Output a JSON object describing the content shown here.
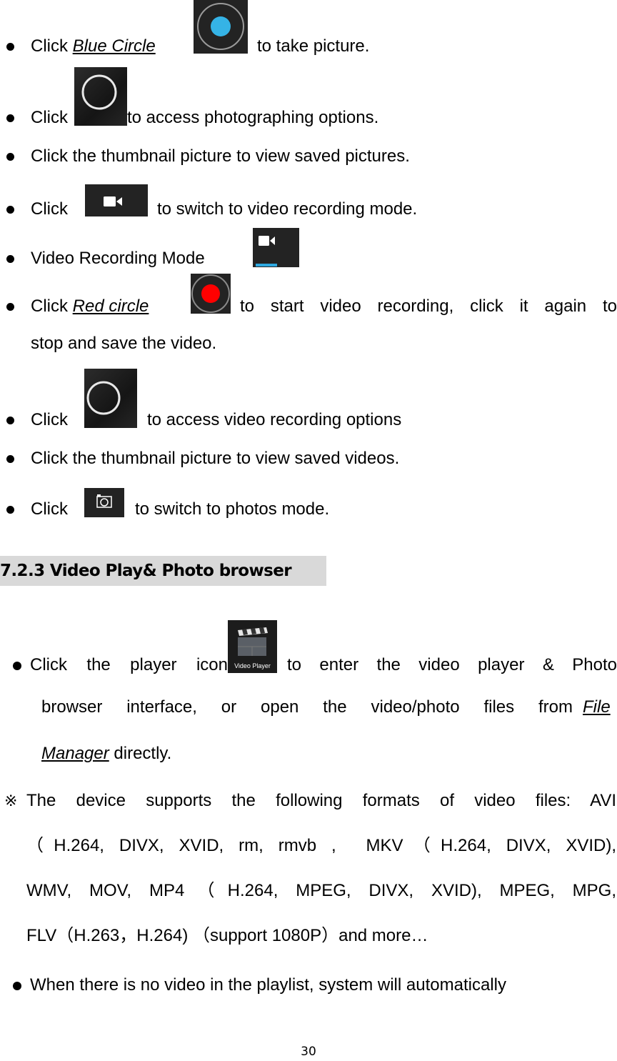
{
  "camera_section": {
    "item1": {
      "pre": "Click ",
      "link": "Blue Circle",
      "post": " to take picture.",
      "icon": "shutter-blue-circle-icon"
    },
    "item2": {
      "pre": "Click",
      "post": "to access photographing options.",
      "icon": "options-ring-icon"
    },
    "item3": {
      "text": "Click the thumbnail picture to view saved pictures."
    },
    "item4": {
      "pre": "Click ",
      "post": " to switch to video recording mode.",
      "icon": "video-camera-icon"
    },
    "item5": {
      "text": "Video Recording Mode ",
      "icon": "video-mode-active-icon"
    },
    "item6": {
      "pre": "Click ",
      "link": "Red circle",
      "post": " to start video recording, click it again to",
      "cont": "stop and save the video.",
      "icon": "record-red-circle-icon"
    },
    "item7": {
      "pre": "Click ",
      "post": " to access video recording options",
      "icon": "options-ring-icon"
    },
    "item8": {
      "text": "Click the thumbnail picture to view saved videos."
    },
    "item9": {
      "pre": "Click ",
      "post": " to switch to photos mode.",
      "icon": "photo-camera-icon"
    }
  },
  "section_heading": "7.2.3 Video Play& Photo browser",
  "player_section": {
    "item1": {
      "pre": "Click the player icon",
      "icon_label": "Video Player",
      "post": " to enter the video player & Photo",
      "line2_pre": "browser interface, or open the video/photo files from ",
      "line2_link": "File",
      "line3_link": "Manager",
      "line3_post": " directly."
    },
    "note": {
      "star": "※",
      "line1": "The device supports the following formats of video files: AVI",
      "line2": "（H.264, DIVX, XVID, rm, rmvb ,  MKV（H.264, DIVX, XVID),",
      "line3": "WMV, MOV, MP4（H.264, MPEG, DIVX, XVID), MPEG, MPG,",
      "line4": "FLV（H.263，H.264) （support 1080P）and more…"
    },
    "item2": {
      "text": "When there is no video in the playlist, system will automatically"
    }
  },
  "page_number": "30",
  "colors": {
    "blue_shutter": "#35b3e6",
    "red_record": "#ff0000",
    "icon_bg": "#232323",
    "heading_bg": "#d9d9d9",
    "active_underline": "#2ea8e0"
  }
}
